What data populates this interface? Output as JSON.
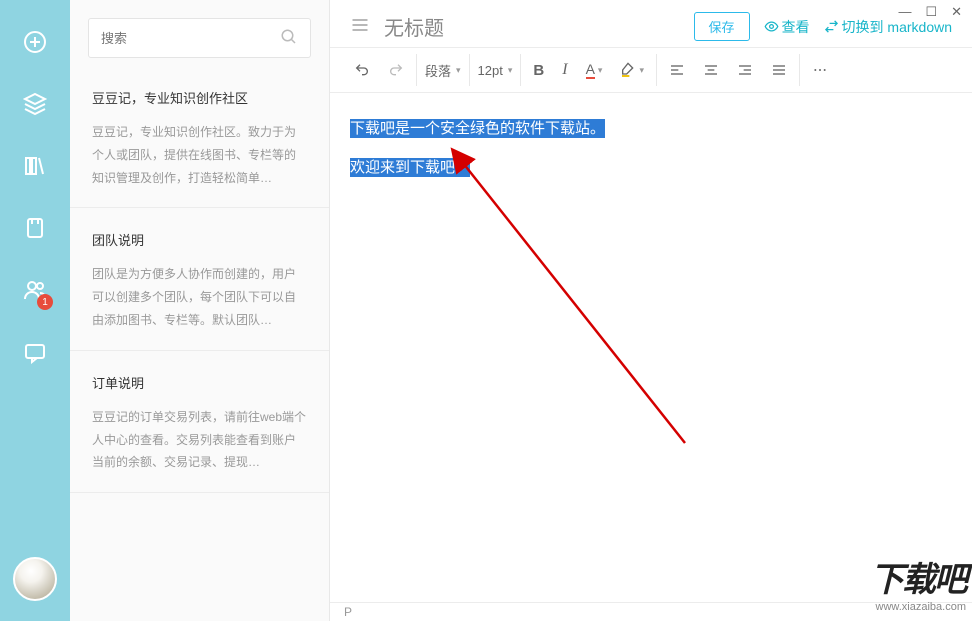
{
  "sidebar": {
    "badge": "1",
    "icons": [
      "add",
      "stack",
      "books",
      "note",
      "team",
      "chat"
    ]
  },
  "search": {
    "placeholder": "搜索"
  },
  "notes": [
    {
      "title": "豆豆记，专业知识创作社区",
      "desc": "豆豆记，专业知识创作社区。致力于为个人或团队，提供在线图书、专栏等的知识管理及创作，打造轻松简单…"
    },
    {
      "title": "团队说明",
      "desc": "团队是为方便多人协作而创建的，用户可以创建多个团队，每个团队下可以自由添加图书、专栏等。默认团队…"
    },
    {
      "title": "订单说明",
      "desc": "豆豆记的订单交易列表，请前往web端个人中心的查看。交易列表能查看到账户当前的余额、交易记录、提现…"
    }
  ],
  "editor": {
    "title": "无标题",
    "save": "保存",
    "view": "查看",
    "switch": "切换到 markdown",
    "paragraph": "段落",
    "fontsize": "12pt",
    "line1": "下载吧是一个安全绿色的软件下载站。",
    "line2": "欢迎来到下载吧！",
    "status": "P"
  },
  "watermark": {
    "big": "下载吧",
    "small": "www.xiazaiba.com"
  }
}
